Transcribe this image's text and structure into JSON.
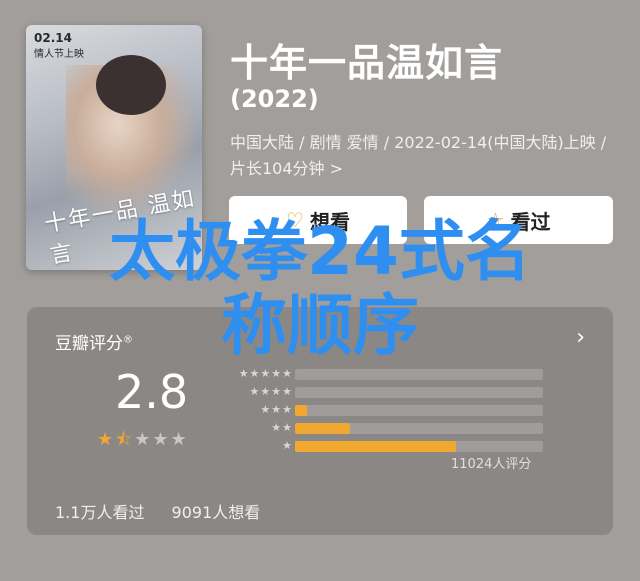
{
  "poster": {
    "date": "02.14",
    "tag": "情人节上映",
    "title": "十年一品 温如言"
  },
  "movie": {
    "title": "十年一品温如言",
    "year": "(2022)",
    "meta": "中国大陆 / 剧情 爱情 / 2022-02-14(中国大陆)上映 / 片长104分钟 >"
  },
  "buttons": {
    "want": "想看",
    "seen": "看过",
    "want_icon": "heart-icon",
    "seen_icon": "star-icon"
  },
  "rating": {
    "label": "豆瓣评分",
    "label_mark": "®",
    "score": "2.8",
    "stars": {
      "filled": 1,
      "half": 1,
      "empty": 3
    },
    "distribution": [
      {
        "stars": 5,
        "fraction": 0.0
      },
      {
        "stars": 4,
        "fraction": 0.0
      },
      {
        "stars": 3,
        "fraction": 0.05
      },
      {
        "stars": 2,
        "fraction": 0.22
      },
      {
        "stars": 1,
        "fraction": 0.65
      }
    ],
    "count": "11024人评分"
  },
  "footer": {
    "seen": "1.1万人看过",
    "want": "9091人想看"
  },
  "overlay": {
    "line1": "太极拳24式名",
    "line2": "称顺序"
  },
  "colors": {
    "accent": "#f0a830",
    "overlay": "#2f8ff0",
    "background": "#a29e9b"
  }
}
